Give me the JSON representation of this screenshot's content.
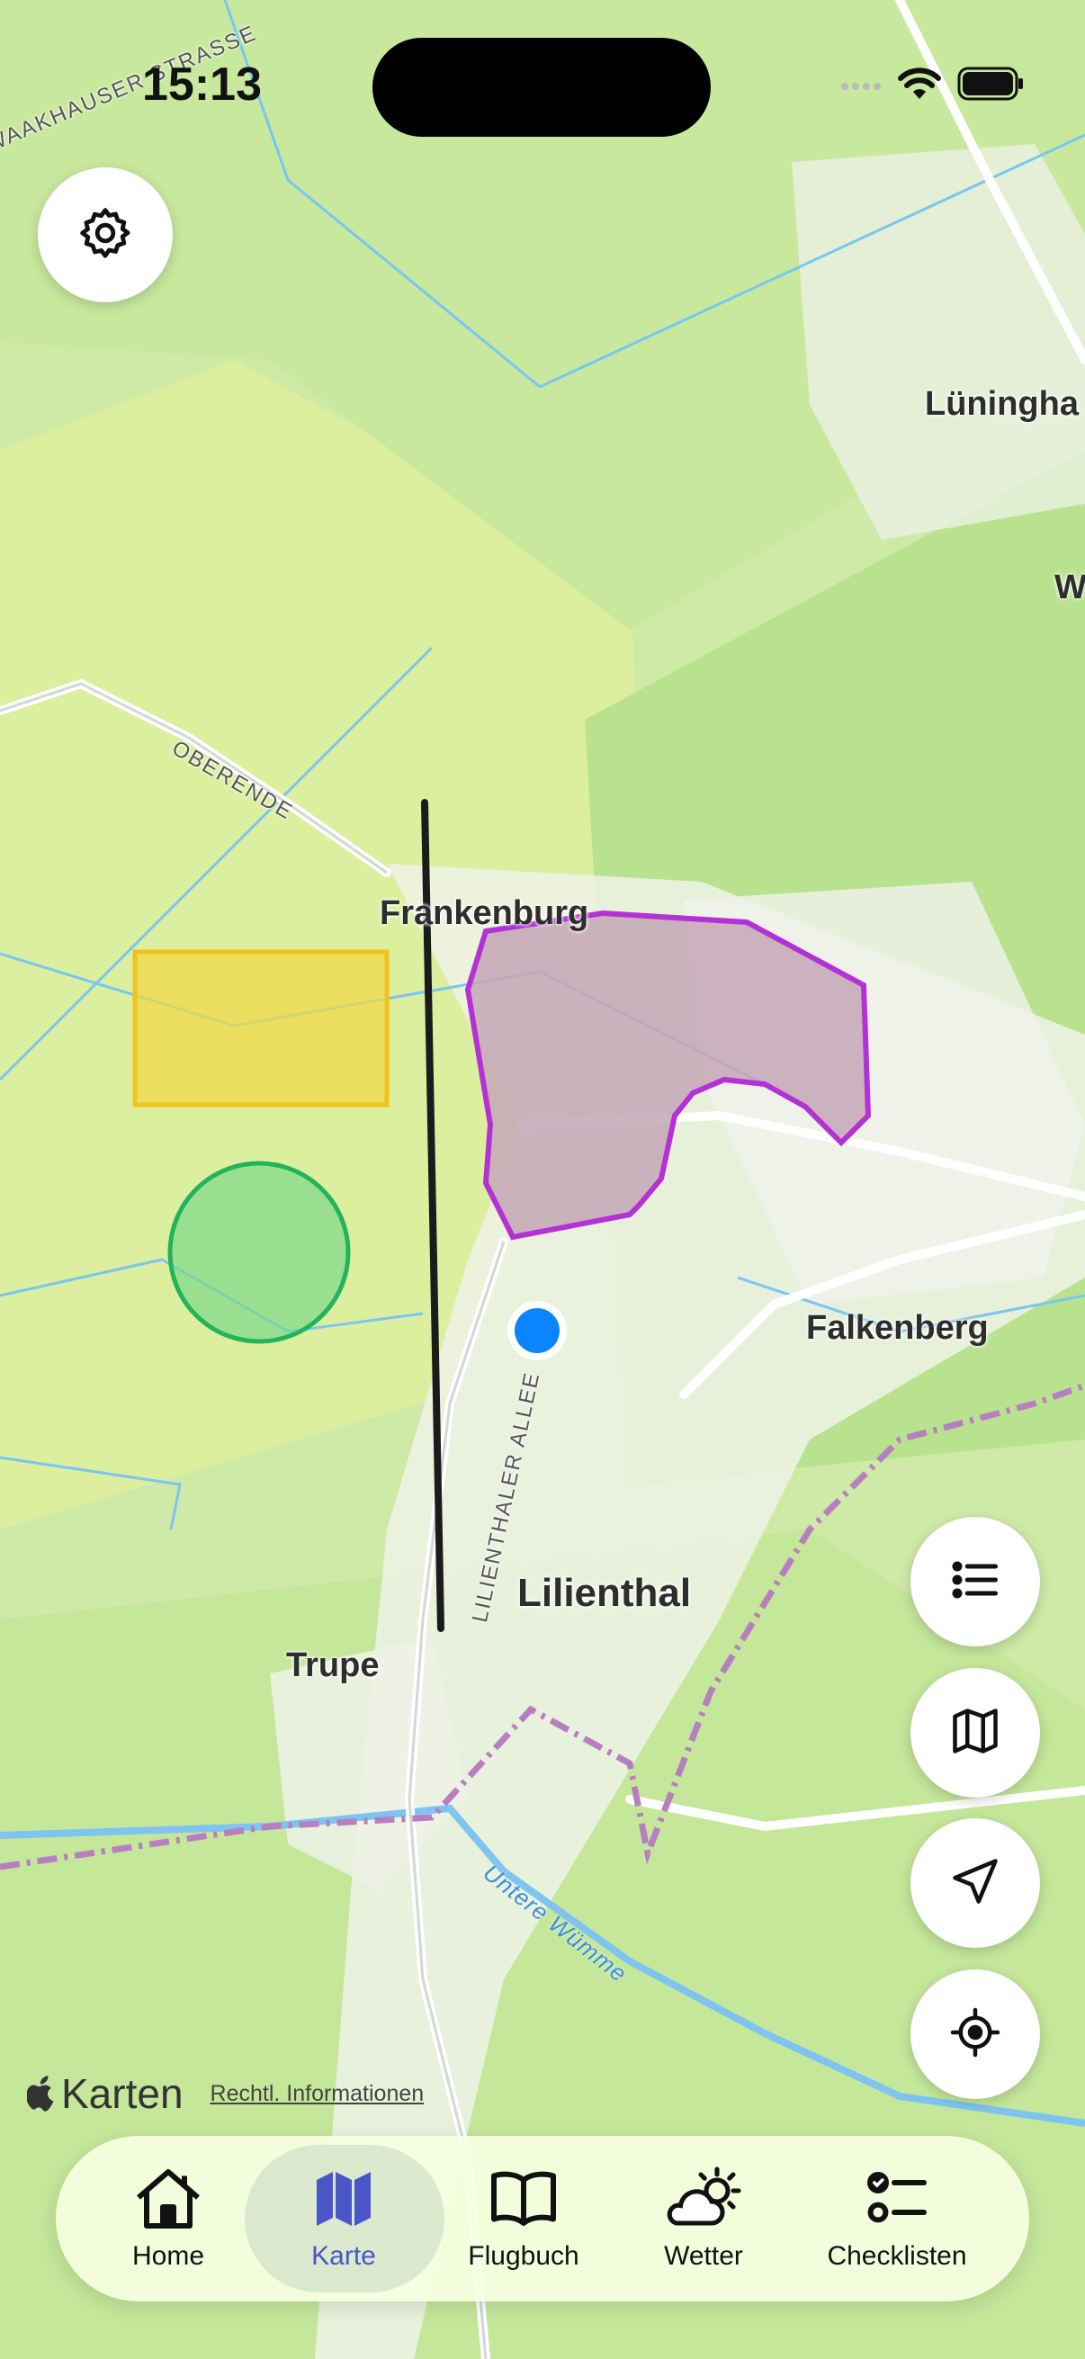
{
  "status": {
    "time": "15:13"
  },
  "map": {
    "labels": {
      "street_top": "WAAKHAUSER STRASSE",
      "oberende": "OBERENDE",
      "luninghaus": "Lüningha",
      "w_partial": "W",
      "frankenburg": "Frankenburg",
      "falkenberg": "Falkenberg",
      "lilienthal": "Lilienthal",
      "trupe": "Trupe",
      "allee": "LILIENTHALER ALLEE",
      "river": "Untere Wümme"
    },
    "colors": {
      "restricted_zone": "#b431d6",
      "yellow_zone": "#f2c21f",
      "green_zone": "#22b45a",
      "location": "#0a84ff"
    }
  },
  "attribution": {
    "brand": "Karten",
    "legal": "Rechtl. Informationen"
  },
  "fabs": {
    "list": "list-icon",
    "map": "map-icon",
    "navigate": "location-arrow-icon",
    "locate": "crosshair-icon"
  },
  "tabs": [
    {
      "label": "Home",
      "icon": "house-icon"
    },
    {
      "label": "Karte",
      "icon": "map-icon",
      "active": true
    },
    {
      "label": "Flugbuch",
      "icon": "book-icon"
    },
    {
      "label": "Wetter",
      "icon": "cloud-sun-icon"
    },
    {
      "label": "Checklisten",
      "icon": "checklist-icon"
    }
  ]
}
